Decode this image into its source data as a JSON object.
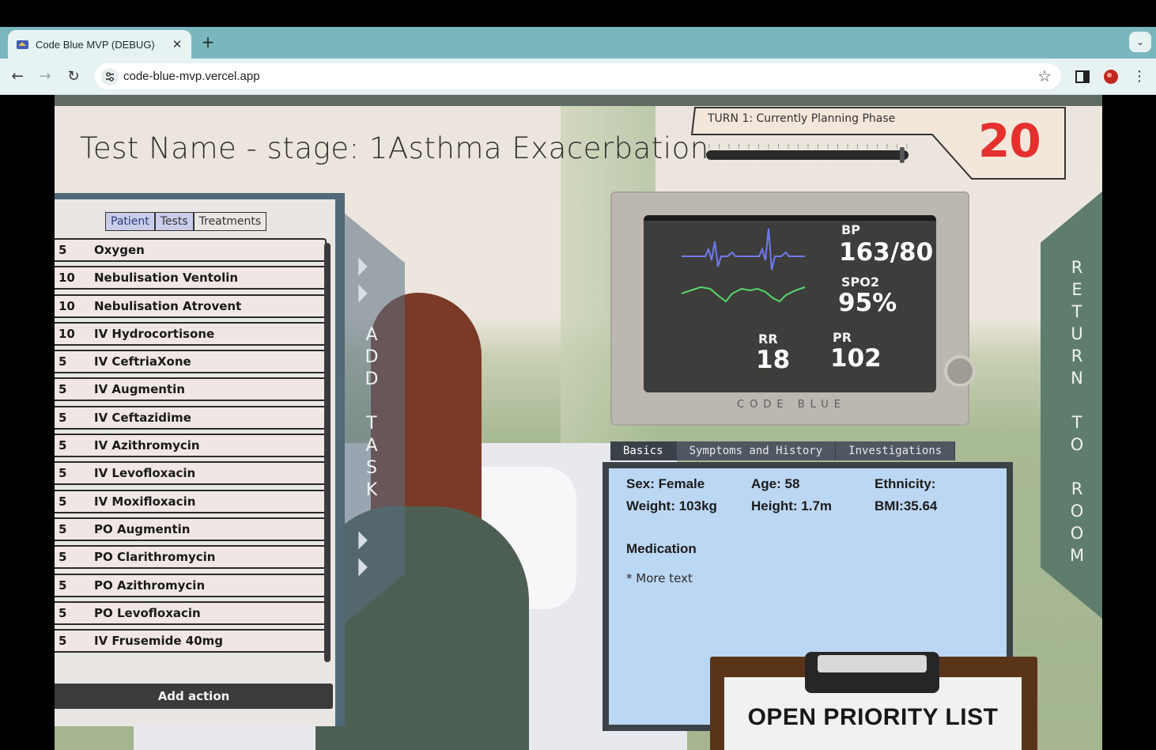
{
  "browser": {
    "tab_title": "Code Blue MVP (DEBUG)",
    "tab_close": "✕",
    "new_tab": "+",
    "url": "code-blue-mvp.vercel.app"
  },
  "game": {
    "stage_title": "Test Name - stage: 1Asthma Exacerbation",
    "turn_label": "TURN 1: Currently Planning Phase",
    "turn_count": "20",
    "turn_progress": 0.98,
    "panel_tabs": [
      "Patient",
      "Tests",
      "Treatments"
    ],
    "actions": [
      {
        "cost": "5",
        "name": "Oxygen"
      },
      {
        "cost": "10",
        "name": "Nebulisation Ventolin"
      },
      {
        "cost": "10",
        "name": "Nebulisation Atrovent"
      },
      {
        "cost": "10",
        "name": "IV Hydrocortisone"
      },
      {
        "cost": "5",
        "name": "IV CeftriaXone"
      },
      {
        "cost": "5",
        "name": "IV Augmentin"
      },
      {
        "cost": "5",
        "name": "IV Ceftazidime"
      },
      {
        "cost": "5",
        "name": "IV Azithromycin"
      },
      {
        "cost": "5",
        "name": "IV Levofloxacin"
      },
      {
        "cost": "5",
        "name": "IV Moxifloxacin"
      },
      {
        "cost": "5",
        "name": "PO Augmentin"
      },
      {
        "cost": "5",
        "name": "PO Clarithromycin"
      },
      {
        "cost": "5",
        "name": "PO Azithromycin"
      },
      {
        "cost": "5",
        "name": "PO Levofloxacin"
      },
      {
        "cost": "5",
        "name": "IV Frusemide 40mg"
      }
    ],
    "add_action": "Add action",
    "add_task_letters": [
      "A",
      "D",
      "D",
      "",
      "T",
      "A",
      "S",
      "K"
    ],
    "monitor": {
      "bp_label": "BP",
      "bp_value": "163/80",
      "spo2_label": "SPO2",
      "spo2_value": "95%",
      "rr_label": "RR",
      "rr_value": "18",
      "pr_label": "PR",
      "pr_value": "102",
      "brand": "CODE BLUE"
    },
    "info_tabs": [
      "Basics",
      "Symptoms and History",
      "Investigations"
    ],
    "info": {
      "sex": "Sex: Female",
      "age": "Age: 58",
      "ethnicity": "Ethnicity:",
      "weight": "Weight: 103kg",
      "height": "Height: 1.7m",
      "bmi": "BMI:35.64",
      "medication_heading": "Medication",
      "medication_note": "* More text"
    },
    "return_letters": [
      "R",
      "E",
      "T",
      "U",
      "R",
      "N",
      "",
      "T",
      "O",
      "",
      "R",
      "O",
      "O",
      "M"
    ],
    "priority_list": "OPEN PRIORITY LIST"
  },
  "colors": {
    "tabbar": "#7ab6be",
    "turn_count": "#e5302d",
    "panel_frame": "#506a78",
    "info_panel": "#bcd7f3",
    "ecg_line": "#6f7bf0",
    "pleth_line": "#56d96b"
  }
}
